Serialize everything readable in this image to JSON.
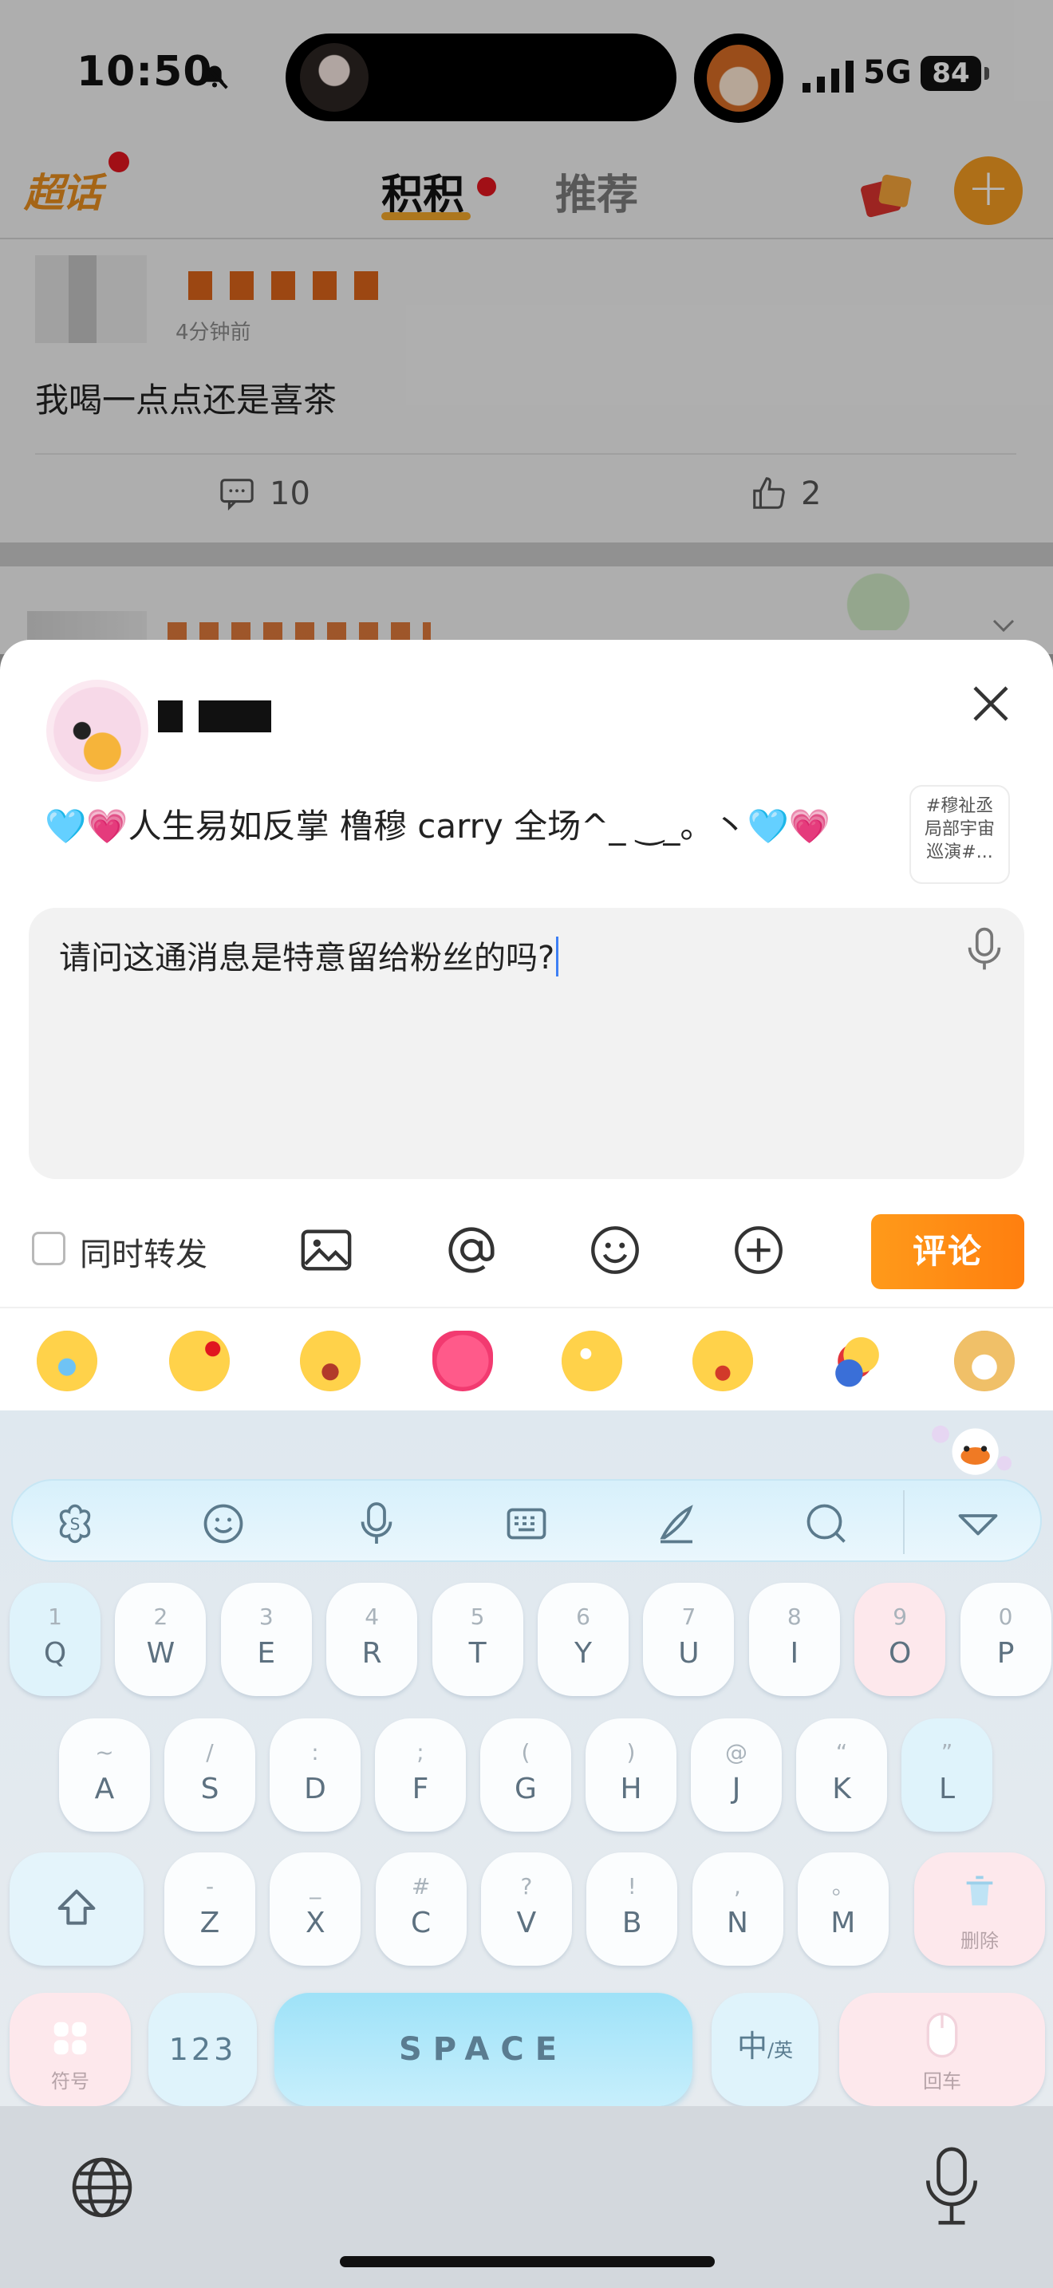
{
  "status_bar": {
    "time": "10:50",
    "network": "5G",
    "battery": "84"
  },
  "header": {
    "logo": "超话",
    "tabs": [
      {
        "label": "积积",
        "active": true
      },
      {
        "label": "推荐",
        "active": false
      }
    ],
    "add_label": "+"
  },
  "post": {
    "meta": "4分钟前",
    "text": "我喝一点点还是喜茶",
    "comment_count": "10",
    "like_count": "2"
  },
  "sheet": {
    "topic_prefix": "🩵💗",
    "topic_text": "人生易如反掌 橹穆 carry 全场^_ ‿_。丶",
    "topic_suffix": "🩵💗",
    "topic_card": "#穆祉丞局部宇宙巡演#...",
    "input_value": "请问这通消息是特意留给粉丝的吗?",
    "repost_label": "同时转发",
    "submit_label": "评论"
  },
  "keyboard": {
    "row1": [
      {
        "sub": "1",
        "main": "Q"
      },
      {
        "sub": "2",
        "main": "W"
      },
      {
        "sub": "3",
        "main": "E"
      },
      {
        "sub": "4",
        "main": "R"
      },
      {
        "sub": "5",
        "main": "T"
      },
      {
        "sub": "6",
        "main": "Y"
      },
      {
        "sub": "7",
        "main": "U"
      },
      {
        "sub": "8",
        "main": "I"
      },
      {
        "sub": "9",
        "main": "O"
      },
      {
        "sub": "0",
        "main": "P"
      }
    ],
    "row2": [
      {
        "sub": "~",
        "main": "A"
      },
      {
        "sub": "/",
        "main": "S"
      },
      {
        "sub": ":",
        "main": "D"
      },
      {
        "sub": ";",
        "main": "F"
      },
      {
        "sub": "(",
        "main": "G"
      },
      {
        "sub": ")",
        "main": "H"
      },
      {
        "sub": "@",
        "main": "J"
      },
      {
        "sub": "“",
        "main": "K"
      },
      {
        "sub": "”",
        "main": "L"
      }
    ],
    "row3": [
      {
        "sub": "-",
        "main": "Z"
      },
      {
        "sub": "_",
        "main": "X"
      },
      {
        "sub": "#",
        "main": "C"
      },
      {
        "sub": "?",
        "main": "V"
      },
      {
        "sub": "!",
        "main": "B"
      },
      {
        "sub": ",",
        "main": "N"
      },
      {
        "sub": "。",
        "main": "M"
      }
    ],
    "delete_label": "删除",
    "symbol_label": "符号",
    "num_label": "123",
    "space_label": "SPACE",
    "lang_label": "中",
    "lang_sub": "/英",
    "enter_label": "回车"
  },
  "colors": {
    "accent": "#ff8a14",
    "tab_dot": "#e0161f",
    "caret": "#3d7ff5"
  }
}
